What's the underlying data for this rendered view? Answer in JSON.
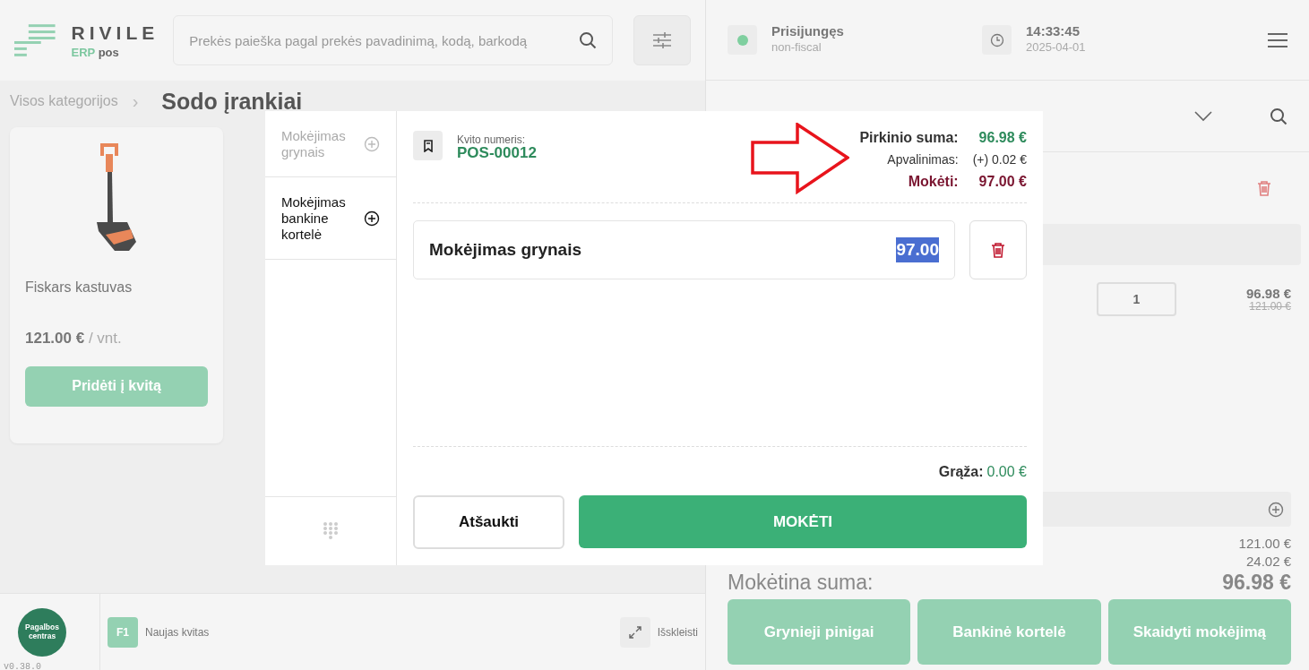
{
  "header": {
    "logo": {
      "name": "RIVILE",
      "sub1": "ERP",
      "sub2": "pos"
    },
    "search": {
      "placeholder": "Prekės paieška pagal prekės pavadinimą, kodą, barkodą"
    }
  },
  "breadcrumb": {
    "root": "Visos kategorijos",
    "separator": "›",
    "current": "Sodo įrankiai"
  },
  "products": [
    {
      "name": "Fiskars kastuvas",
      "price": "121.00 €",
      "unit": "/ vnt.",
      "button": "Pridėti į kvitą"
    }
  ],
  "footer": {
    "help": "Pagalbos centras",
    "version": "v0.38.0",
    "shortcuts": [
      {
        "key": "F1",
        "label": "Naujas kvitas"
      }
    ],
    "expand": "Išskleisti"
  },
  "status": {
    "connection": "Prisijungęs",
    "mode": "non-fiscal",
    "time": "14:33:45",
    "date": "2025-04-01"
  },
  "line": {
    "qty": "1",
    "price": "96.98 €",
    "old_price": "121.00 €"
  },
  "totals": {
    "subtotal": "121.00 €",
    "discount": "24.02 €",
    "due_label": "Mokėtina suma:",
    "due": "96.98 €"
  },
  "pay_buttons": [
    "Grynieji pinigai",
    "Bankinė kortelė",
    "Skaidyti mokėjimą"
  ],
  "dialog": {
    "methods": [
      {
        "label": "Mokėjimas grynais",
        "disabled": true
      },
      {
        "label": "Mokėjimas bankine kortelė",
        "disabled": false
      }
    ],
    "receipt_label": "Kvito numeris:",
    "receipt_no": "POS-00012",
    "summary": [
      {
        "kind": "total",
        "label": "Pirkinio suma:",
        "value": "96.98 €"
      },
      {
        "kind": "rounding",
        "label": "Apvalinimas:",
        "value": "(+) 0.02 €"
      },
      {
        "kind": "due",
        "label": "Mokėti:",
        "value": "97.00 €"
      }
    ],
    "payments": [
      {
        "label": "Mokėjimas grynais",
        "amount": "97.00",
        "highlighted": true
      }
    ],
    "change_label": "Grąža:",
    "change": "0.00 €",
    "cancel": "Atšaukti",
    "pay": "MOKĖTI"
  }
}
